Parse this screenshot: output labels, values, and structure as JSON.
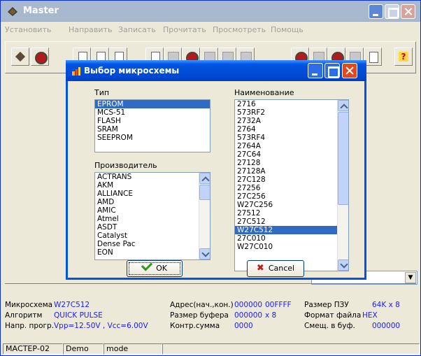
{
  "window": {
    "title": "Master"
  },
  "menu": [
    "Установить",
    "Направить",
    "Записать",
    "Прочитать",
    "Просмотреть",
    "Помощь"
  ],
  "dialog": {
    "title": "Выбор микросхемы",
    "type_label": "Тип",
    "types": [
      "EPROM",
      "MCS-51",
      "FLASH",
      "SRAM",
      "SEEPROM"
    ],
    "type_selected": 0,
    "manufacturer_label": "Производитель",
    "manufacturers": [
      "ACTRANS",
      "AKM",
      "ALLIANCE",
      "AMD",
      "AMIC",
      "Atmel",
      "ASDT",
      "Catalyst",
      "Dense Pac",
      "EON"
    ],
    "name_label": "Наименование",
    "names": [
      "2716",
      "573RF2",
      "2732A",
      "2764",
      "573RF4",
      "2764A",
      "27C64",
      "27128",
      "27128A",
      "27C128",
      "27256",
      "27C256",
      "W27C256",
      "27512",
      "27C512",
      "W27C512",
      "27C010",
      "W27C010"
    ],
    "name_selected": 15,
    "ok_label": "OK",
    "cancel_label": "Cancel"
  },
  "info": {
    "chip_label": "Микросхема",
    "chip_value": "W27C512",
    "algo_label": "Алгоритм",
    "algo_value": "QUICK PULSE",
    "volt_label": "Напр. прогр.",
    "volt_value": "Vpp=12.50V , Vcc=6.00V",
    "addr_label": "Адрес(нач.,кон.)",
    "addr_start": "000000",
    "addr_end": "00FFFF",
    "buf_label": "Размер буфера",
    "buf_value": "000000",
    "buf_mult": "x 8",
    "chk_label": "Контр.сумма",
    "chk_value": "0000",
    "size_label": "Размер ПЗУ",
    "size_value": "64K x 8",
    "fmt_label": "Формат файла",
    "fmt_value": "HEX",
    "off_label": "Смещ. в буф.",
    "off_value": "000000"
  },
  "status": {
    "device": "МАСТЕР-02",
    "demo": "Demo",
    "mode": "mode"
  }
}
